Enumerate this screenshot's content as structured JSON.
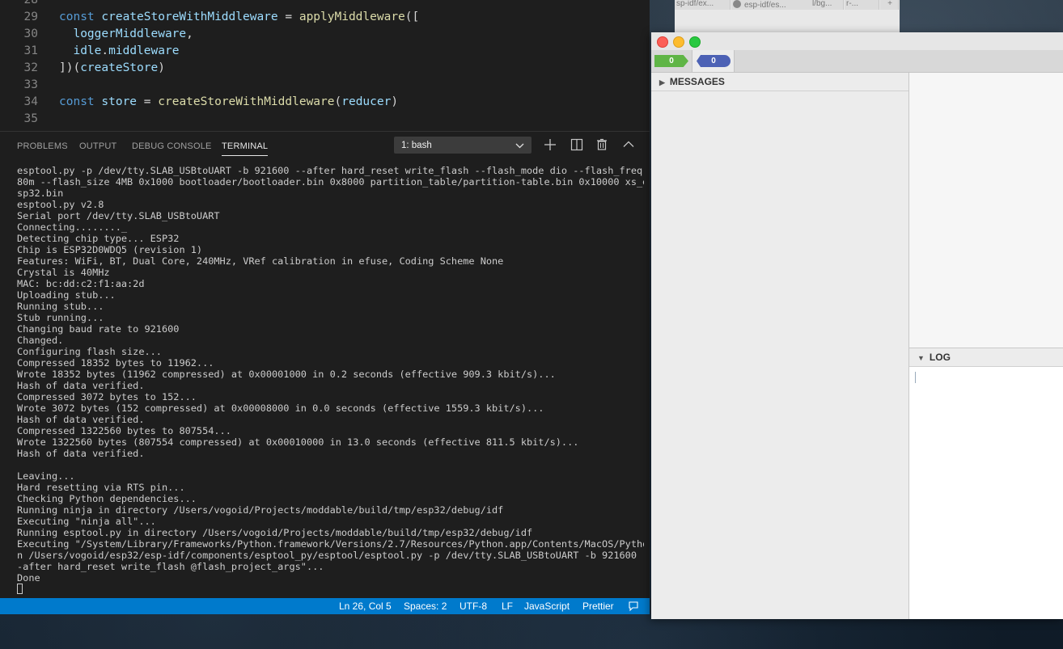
{
  "editor": {
    "code_lines": [
      {
        "num": "28",
        "html_tokens": []
      },
      {
        "num": "29",
        "html_tokens": [
          [
            "k",
            "const "
          ],
          [
            "v",
            "createStoreWithMiddleware"
          ],
          [
            "p",
            " = "
          ],
          [
            "f",
            "applyMiddleware"
          ],
          [
            "p",
            "(["
          ]
        ]
      },
      {
        "num": "30",
        "html_tokens": [
          [
            "p",
            "  "
          ],
          [
            "v",
            "loggerMiddleware"
          ],
          [
            "p",
            ","
          ]
        ]
      },
      {
        "num": "31",
        "html_tokens": [
          [
            "p",
            "  "
          ],
          [
            "v",
            "idle"
          ],
          [
            "p",
            "."
          ],
          [
            "v",
            "middleware"
          ]
        ]
      },
      {
        "num": "32",
        "html_tokens": [
          [
            "p",
            "])("
          ],
          [
            "v",
            "createStore"
          ],
          [
            "p",
            ")"
          ]
        ]
      },
      {
        "num": "33",
        "html_tokens": []
      },
      {
        "num": "34",
        "html_tokens": [
          [
            "k",
            "const "
          ],
          [
            "v",
            "store"
          ],
          [
            "p",
            " = "
          ],
          [
            "f",
            "createStoreWithMiddleware"
          ],
          [
            "p",
            "("
          ],
          [
            "v",
            "reducer"
          ],
          [
            "p",
            ")"
          ]
        ]
      },
      {
        "num": "35",
        "html_tokens": []
      }
    ],
    "panel_tabs": {
      "problems": "PROBLEMS",
      "output": "OUTPUT",
      "debug_console": "DEBUG CONSOLE",
      "terminal": "TERMINAL"
    },
    "terminal_selector": "1: bash",
    "terminal_lines": [
      "esptool.py -p /dev/tty.SLAB_USBtoUART -b 921600 --after hard_reset write_flash --flash_mode dio --flash_freq",
      "80m --flash_size 4MB 0x1000 bootloader/bootloader.bin 0x8000 partition_table/partition-table.bin 0x10000 xs_e",
      "sp32.bin",
      "esptool.py v2.8",
      "Serial port /dev/tty.SLAB_USBtoUART",
      "Connecting........_",
      "Detecting chip type... ESP32",
      "Chip is ESP32D0WDQ5 (revision 1)",
      "Features: WiFi, BT, Dual Core, 240MHz, VRef calibration in efuse, Coding Scheme None",
      "Crystal is 40MHz",
      "MAC: bc:dd:c2:f1:aa:2d",
      "Uploading stub...",
      "Running stub...",
      "Stub running...",
      "Changing baud rate to 921600",
      "Changed.",
      "Configuring flash size...",
      "Compressed 18352 bytes to 11962...",
      "Wrote 18352 bytes (11962 compressed) at 0x00001000 in 0.2 seconds (effective 909.3 kbit/s)...",
      "Hash of data verified.",
      "Compressed 3072 bytes to 152...",
      "Wrote 3072 bytes (152 compressed) at 0x00008000 in 0.0 seconds (effective 1559.3 kbit/s)...",
      "Hash of data verified.",
      "Compressed 1322560 bytes to 807554...",
      "Wrote 1322560 bytes (807554 compressed) at 0x00010000 in 13.0 seconds (effective 811.5 kbit/s)...",
      "Hash of data verified.",
      "",
      "Leaving...",
      "Hard resetting via RTS pin...",
      "Checking Python dependencies...",
      "Running ninja in directory /Users/vogoid/Projects/moddable/build/tmp/esp32/debug/idf",
      "Executing \"ninja all\"...",
      "Running esptool.py in directory /Users/vogoid/Projects/moddable/build/tmp/esp32/debug/idf",
      "Executing \"/System/Library/Frameworks/Python.framework/Versions/2.7/Resources/Python.app/Contents/MacOS/Pytho",
      "n /Users/vogoid/esp32/esp-idf/components/esptool_py/esptool/esptool.py -p /dev/tty.SLAB_USBtoUART -b 921600 -",
      "-after hard_reset write_flash @flash_project_args\"...",
      "Done"
    ],
    "statusbar": {
      "position": "Ln 26, Col 5",
      "spaces": "Spaces: 2",
      "encoding": "UTF-8",
      "eol": "LF",
      "language": "JavaScript",
      "formatter": "Prettier"
    }
  },
  "background_tabs": [
    "sp-idf/ex...",
    "esp-idf/es...",
    "l/bg...",
    "r-..."
  ],
  "debugger": {
    "badges": {
      "errors": "0",
      "messages": "0"
    },
    "messages_label": "MESSAGES",
    "log_label": "LOG",
    "colors": {
      "green": "#5fb546",
      "blue": "#4d62b5",
      "red": "#fc5f57",
      "yellow": "#fdbc2e",
      "traffic_green": "#28c840"
    }
  },
  "colors": {
    "statusbar": "#007acc",
    "editor_bg": "#1e1e1e"
  }
}
